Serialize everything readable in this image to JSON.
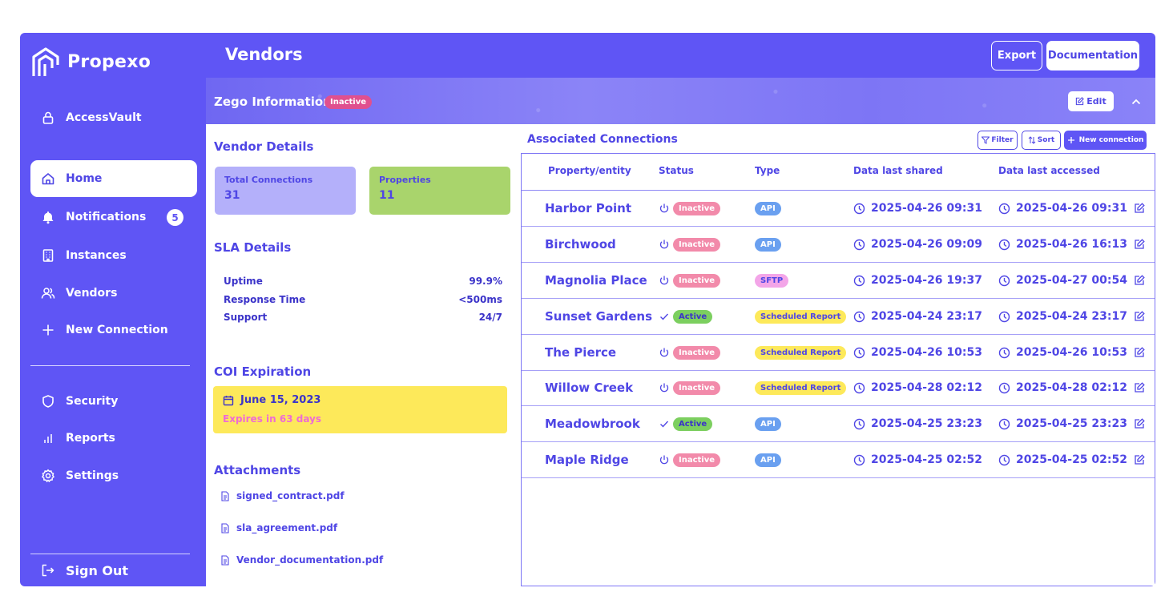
{
  "app": {
    "name": "Propexo"
  },
  "colors": {
    "primary": "#5f55f5",
    "accent_text": "#4f46e5",
    "inactive": "#f28aaa",
    "active": "#7ccf5f",
    "api": "#6aa0f0",
    "sftp": "#f3a5e8",
    "scheduled": "#fde95a"
  },
  "sidebar": {
    "items": [
      {
        "label": "AccessVault",
        "icon": "lock-icon"
      },
      {
        "label": "Home",
        "icon": "home-icon",
        "active": true
      },
      {
        "label": "Notifications",
        "icon": "bell-icon",
        "badge": "5"
      },
      {
        "label": "Instances",
        "icon": "building-icon"
      },
      {
        "label": "Vendors",
        "icon": "users-icon"
      },
      {
        "label": "New Connection",
        "icon": "plus-icon"
      },
      {
        "label": "Security",
        "icon": "shield-icon"
      },
      {
        "label": "Reports",
        "icon": "bar-chart-icon"
      },
      {
        "label": "Settings",
        "icon": "gear-icon"
      }
    ],
    "signout": "Sign Out"
  },
  "header": {
    "title": "Vendors",
    "export_label": "Export",
    "doc_label": "Documentation"
  },
  "banner": {
    "title": "Zego Information",
    "status": "Inactive",
    "edit_label": "Edit"
  },
  "vendor_details": {
    "title": "Vendor Details",
    "total_connections_label": "Total Connections",
    "total_connections": "31",
    "properties_label": "Properties",
    "properties": "11"
  },
  "sla": {
    "title": "SLA Details",
    "rows": [
      {
        "label": "Uptime",
        "value": "99.9%"
      },
      {
        "label": "Response Time",
        "value": "<500ms"
      },
      {
        "label": "Support",
        "value": "24/7"
      }
    ]
  },
  "coi": {
    "title": "COI Expiration",
    "date": "June 15, 2023",
    "expires": "Expires in 63 days"
  },
  "attachments": {
    "title": "Attachments",
    "files": [
      "signed_contract.pdf",
      "sla_agreement.pdf",
      "Vendor_documentation.pdf"
    ]
  },
  "connections": {
    "title": "Associated Connections",
    "filter_label": "Filter",
    "sort_label": "Sort",
    "new_label": "New connection",
    "columns": [
      "Property/entity",
      "Status",
      "Type",
      "Data last shared",
      "Data last accessed"
    ],
    "rows": [
      {
        "name": "Harbor Point",
        "status": "Inactive",
        "type": "API",
        "shared": "2025-04-26 09:31",
        "accessed": "2025-04-26 09:31"
      },
      {
        "name": "Birchwood",
        "status": "Inactive",
        "type": "API",
        "shared": "2025-04-26 09:09",
        "accessed": "2025-04-26 16:13"
      },
      {
        "name": "Magnolia Place",
        "status": "Inactive",
        "type": "SFTP",
        "shared": "2025-04-26 19:37",
        "accessed": "2025-04-27 00:54"
      },
      {
        "name": "Sunset Gardens",
        "status": "Active",
        "type": "Scheduled Report",
        "shared": "2025-04-24 23:17",
        "accessed": "2025-04-24 23:17"
      },
      {
        "name": "The Pierce",
        "status": "Inactive",
        "type": "Scheduled Report",
        "shared": "2025-04-26 10:53",
        "accessed": "2025-04-26 10:53"
      },
      {
        "name": "Willow Creek",
        "status": "Inactive",
        "type": "Scheduled Report",
        "shared": "2025-04-28 02:12",
        "accessed": "2025-04-28 02:12"
      },
      {
        "name": "Meadowbrook",
        "status": "Active",
        "type": "API",
        "shared": "2025-04-25 23:23",
        "accessed": "2025-04-25 23:23"
      },
      {
        "name": "Maple Ridge",
        "status": "Inactive",
        "type": "API",
        "shared": "2025-04-25 02:52",
        "accessed": "2025-04-25 02:52"
      }
    ]
  }
}
